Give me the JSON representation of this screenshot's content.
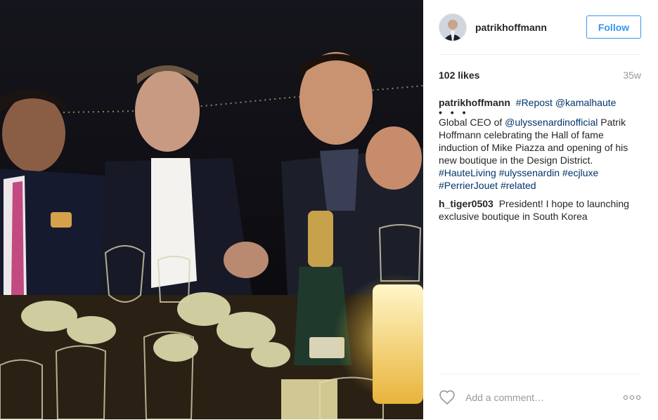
{
  "header": {
    "username": "patrikhoffmann",
    "follow_label": "Follow"
  },
  "meta": {
    "likes": "102 likes",
    "age": "35w"
  },
  "caption": {
    "author": "patrikhoffmann",
    "lead_hashtag": "#Repost",
    "lead_mention": "@kamalhaute",
    "ellipsis": "• • •",
    "text_1": "Global CEO of",
    "mention": "@ulyssenardinofficial",
    "text_2": "Patrik Hoffmann celebrating the Hall of fame induction of Mike Piazza and opening of his new boutique in the Design District.",
    "hashtags": [
      "#HauteLiving",
      "#ulyssenardin",
      "#ecjluxe",
      "#PerrierJouet",
      "#related"
    ]
  },
  "comments": [
    {
      "author": "h_tiger0503",
      "text": "President! I hope to launching exclusive boutique in South Korea"
    }
  ],
  "footer": {
    "comment_placeholder": "Add a comment…",
    "like_icon": "heart-outline-icon",
    "more_icon": "more-options-icon"
  },
  "colors": {
    "accent": "#3897f0",
    "link": "#003569",
    "muted": "#999999",
    "text": "#262626"
  }
}
